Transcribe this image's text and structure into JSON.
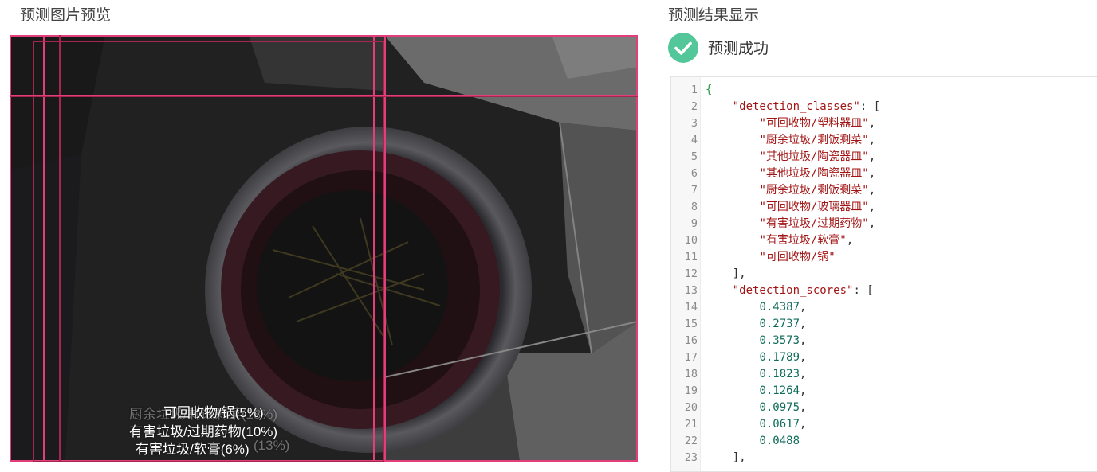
{
  "preview": {
    "title": "预测图片预览"
  },
  "result": {
    "title": "预测结果显示",
    "status_text": "预测成功",
    "status_color": "#54c79a"
  },
  "detections": {
    "labels": [
      {
        "text": "可回收物/锅(5%)"
      },
      {
        "text": "有害垃圾/过期药物(10%)"
      },
      {
        "text": "有害垃圾/软膏(6%)"
      },
      {
        "text": "厨余垃圾/剩饭剩菜(18%)"
      },
      {
        "text": "(13%)"
      }
    ],
    "box_color": "#e23f7a"
  },
  "json_view": {
    "lines": [
      {
        "n": "1",
        "parts": [
          {
            "t": "{",
            "c": "t-brace"
          }
        ]
      },
      {
        "n": "2",
        "parts": [
          {
            "t": "    "
          },
          {
            "t": "\"detection_classes\"",
            "c": "t-key"
          },
          {
            "t": ": [",
            "c": "t-punc"
          }
        ]
      },
      {
        "n": "3",
        "parts": [
          {
            "t": "        "
          },
          {
            "t": "\"可回收物/塑料器皿\"",
            "c": "t-str"
          },
          {
            "t": ",",
            "c": "t-punc"
          }
        ]
      },
      {
        "n": "4",
        "parts": [
          {
            "t": "        "
          },
          {
            "t": "\"厨余垃圾/剩饭剩菜\"",
            "c": "t-str"
          },
          {
            "t": ",",
            "c": "t-punc"
          }
        ]
      },
      {
        "n": "5",
        "parts": [
          {
            "t": "        "
          },
          {
            "t": "\"其他垃圾/陶瓷器皿\"",
            "c": "t-str"
          },
          {
            "t": ",",
            "c": "t-punc"
          }
        ]
      },
      {
        "n": "6",
        "parts": [
          {
            "t": "        "
          },
          {
            "t": "\"其他垃圾/陶瓷器皿\"",
            "c": "t-str"
          },
          {
            "t": ",",
            "c": "t-punc"
          }
        ]
      },
      {
        "n": "7",
        "parts": [
          {
            "t": "        "
          },
          {
            "t": "\"厨余垃圾/剩饭剩菜\"",
            "c": "t-str"
          },
          {
            "t": ",",
            "c": "t-punc"
          }
        ]
      },
      {
        "n": "8",
        "parts": [
          {
            "t": "        "
          },
          {
            "t": "\"可回收物/玻璃器皿\"",
            "c": "t-str"
          },
          {
            "t": ",",
            "c": "t-punc"
          }
        ]
      },
      {
        "n": "9",
        "parts": [
          {
            "t": "        "
          },
          {
            "t": "\"有害垃圾/过期药物\"",
            "c": "t-str"
          },
          {
            "t": ",",
            "c": "t-punc"
          }
        ]
      },
      {
        "n": "10",
        "parts": [
          {
            "t": "        "
          },
          {
            "t": "\"有害垃圾/软膏\"",
            "c": "t-str"
          },
          {
            "t": ",",
            "c": "t-punc"
          }
        ]
      },
      {
        "n": "11",
        "parts": [
          {
            "t": "        "
          },
          {
            "t": "\"可回收物/锅\"",
            "c": "t-str"
          }
        ]
      },
      {
        "n": "12",
        "parts": [
          {
            "t": "    "
          },
          {
            "t": "],",
            "c": "t-punc"
          }
        ]
      },
      {
        "n": "13",
        "parts": [
          {
            "t": "    "
          },
          {
            "t": "\"detection_scores\"",
            "c": "t-key"
          },
          {
            "t": ": [",
            "c": "t-punc"
          }
        ]
      },
      {
        "n": "14",
        "parts": [
          {
            "t": "        "
          },
          {
            "t": "0.4387",
            "c": "t-num"
          },
          {
            "t": ",",
            "c": "t-punc"
          }
        ]
      },
      {
        "n": "15",
        "parts": [
          {
            "t": "        "
          },
          {
            "t": "0.2737",
            "c": "t-num"
          },
          {
            "t": ",",
            "c": "t-punc"
          }
        ]
      },
      {
        "n": "16",
        "parts": [
          {
            "t": "        "
          },
          {
            "t": "0.3573",
            "c": "t-num"
          },
          {
            "t": ",",
            "c": "t-punc"
          }
        ]
      },
      {
        "n": "17",
        "parts": [
          {
            "t": "        "
          },
          {
            "t": "0.1789",
            "c": "t-num"
          },
          {
            "t": ",",
            "c": "t-punc"
          }
        ]
      },
      {
        "n": "18",
        "parts": [
          {
            "t": "        "
          },
          {
            "t": "0.1823",
            "c": "t-num"
          },
          {
            "t": ",",
            "c": "t-punc"
          }
        ]
      },
      {
        "n": "19",
        "parts": [
          {
            "t": "        "
          },
          {
            "t": "0.1264",
            "c": "t-num"
          },
          {
            "t": ",",
            "c": "t-punc"
          }
        ]
      },
      {
        "n": "20",
        "parts": [
          {
            "t": "        "
          },
          {
            "t": "0.0975",
            "c": "t-num"
          },
          {
            "t": ",",
            "c": "t-punc"
          }
        ]
      },
      {
        "n": "21",
        "parts": [
          {
            "t": "        "
          },
          {
            "t": "0.0617",
            "c": "t-num"
          },
          {
            "t": ",",
            "c": "t-punc"
          }
        ]
      },
      {
        "n": "22",
        "parts": [
          {
            "t": "        "
          },
          {
            "t": "0.0488",
            "c": "t-num"
          }
        ]
      },
      {
        "n": "23",
        "parts": [
          {
            "t": "    "
          },
          {
            "t": "],",
            "c": "t-punc"
          }
        ]
      }
    ]
  }
}
